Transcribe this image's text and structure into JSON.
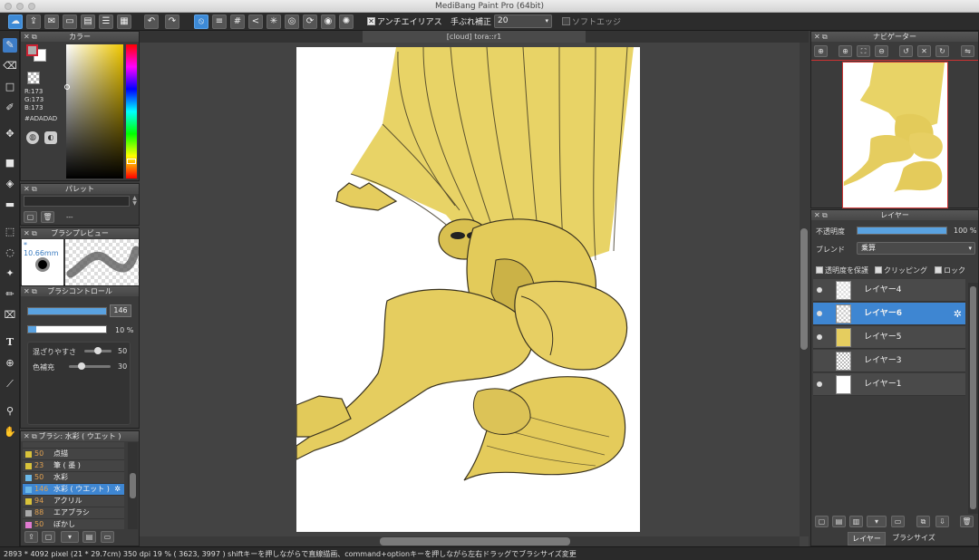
{
  "window": {
    "title": "MediBang Paint Pro (64bit)"
  },
  "toolbar": {
    "antialias_label": "アンチエイリアス",
    "stabilizer_label": "手ぶれ補正",
    "stabilizer_value": "20",
    "soft_edge_label": "ソフトエッジ"
  },
  "document": {
    "tab_title": "[cloud] tora::r1"
  },
  "color_panel": {
    "title": "カラー",
    "r": "R:173",
    "g": "G:173",
    "b": "B:173",
    "hex": "#ADADAD",
    "primary_color": "#ADADAD"
  },
  "palette_panel": {
    "title": "パレット",
    "placeholder": "---"
  },
  "brush_preview_panel": {
    "title": "ブラシプレビュー",
    "size": "* 10.66mm"
  },
  "brush_control_panel": {
    "title": "ブラシコントロール",
    "size_value": "146",
    "size_fraction": 1.0,
    "opacity_value": "10 %",
    "opacity_fraction": 0.1,
    "mix_label": "混ざりやすさ",
    "mix_value": "50",
    "mix_fraction": 0.5,
    "complement_label": "色補充",
    "complement_value": "30",
    "complement_fraction": 0.3
  },
  "brush_list_panel": {
    "title": "ブラシ: 水彩 ( ウエット )",
    "items": [
      {
        "size": "50",
        "name": "点描",
        "color": "#d8c23a"
      },
      {
        "size": "23",
        "name": "筆 ( 墨 )",
        "color": "#d8c23a"
      },
      {
        "size": "50",
        "name": "水彩",
        "color": "#6bb8e8"
      },
      {
        "size": "146",
        "name": "水彩 ( ウエット )",
        "color": "#6bb8e8"
      },
      {
        "size": "94",
        "name": "アクリル",
        "color": "#d8c23a"
      },
      {
        "size": "88",
        "name": "エアブラシ",
        "color": "#aaaaaa"
      },
      {
        "size": "50",
        "name": "ぼかし",
        "color": "#e07ad0"
      }
    ]
  },
  "navigator_panel": {
    "title": "ナビゲーター"
  },
  "layer_panel": {
    "title": "レイヤー",
    "opacity_label": "不透明度",
    "opacity_value": "100 %",
    "opacity_fraction": 1.0,
    "blend_label": "ブレンド",
    "blend_value": "乗算",
    "protect_alpha_label": "透明度を保護",
    "clipping_label": "クリッピング",
    "lock_label": "ロック",
    "layers": [
      {
        "name": "レイヤー4"
      },
      {
        "name": "レイヤー6"
      },
      {
        "name": "レイヤー5"
      },
      {
        "name": "レイヤー3"
      },
      {
        "name": "レイヤー1"
      }
    ],
    "tabs": [
      "レイヤー",
      "ブラシサイズ"
    ]
  },
  "status": {
    "text": "2893 * 4092 pixel  (21 * 29.7cm)  350 dpi  19 %  ( 3623, 3997 )  shiftキーを押しながらで直線描画、command+optionキーを押しながら左右ドラッグでブラシサイズ変更"
  }
}
